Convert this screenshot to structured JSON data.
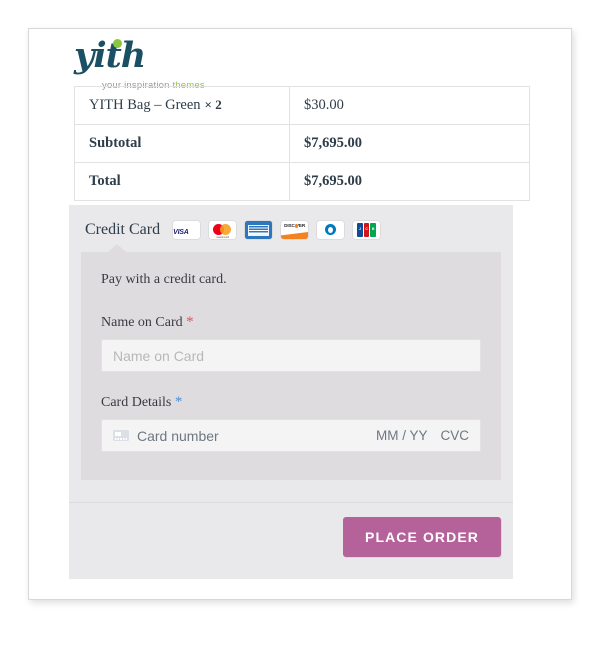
{
  "brand": {
    "logo_word": "yith",
    "tagline_plain": "your inspiration ",
    "tagline_accent": "themes",
    "logo_color": "#1b4f63",
    "accent_color": "#8cc63e"
  },
  "order_table": {
    "rows": [
      {
        "label": "YITH Bag – Green",
        "qty": "× 2",
        "amount": "$30.00",
        "bold": false
      },
      {
        "label": "Subtotal",
        "qty": "",
        "amount": "$7,695.00",
        "bold": true
      },
      {
        "label": "Total",
        "qty": "",
        "amount": "$7,695.00",
        "bold": true
      }
    ]
  },
  "payment": {
    "gateway_title": "Credit Card",
    "accepted_cards": [
      {
        "name": "visa-card-icon",
        "label": "VISA"
      },
      {
        "name": "mastercard-card-icon",
        "label": "mastercard"
      },
      {
        "name": "amex-card-icon",
        "label": "AMERICAN EXPRESS"
      },
      {
        "name": "discover-card-icon",
        "label": "DISC VER"
      },
      {
        "name": "diners-club-card-icon",
        "label": "Diners Club"
      },
      {
        "name": "jcb-card-icon",
        "label": "JCB"
      }
    ],
    "description": "Pay with a credit card.",
    "name_field": {
      "label": "Name on Card",
      "required_mark": "*",
      "required_color": "#e2515e",
      "value": "",
      "placeholder": "Name on Card"
    },
    "card_details": {
      "label": "Card Details",
      "required_mark": "*",
      "required_color": "#4a90d9",
      "number_placeholder": "Card number",
      "expiry_placeholder": "MM / YY",
      "cvc_placeholder": "CVC"
    },
    "submit": {
      "label": "PLACE ORDER",
      "color": "#b5629b"
    }
  }
}
